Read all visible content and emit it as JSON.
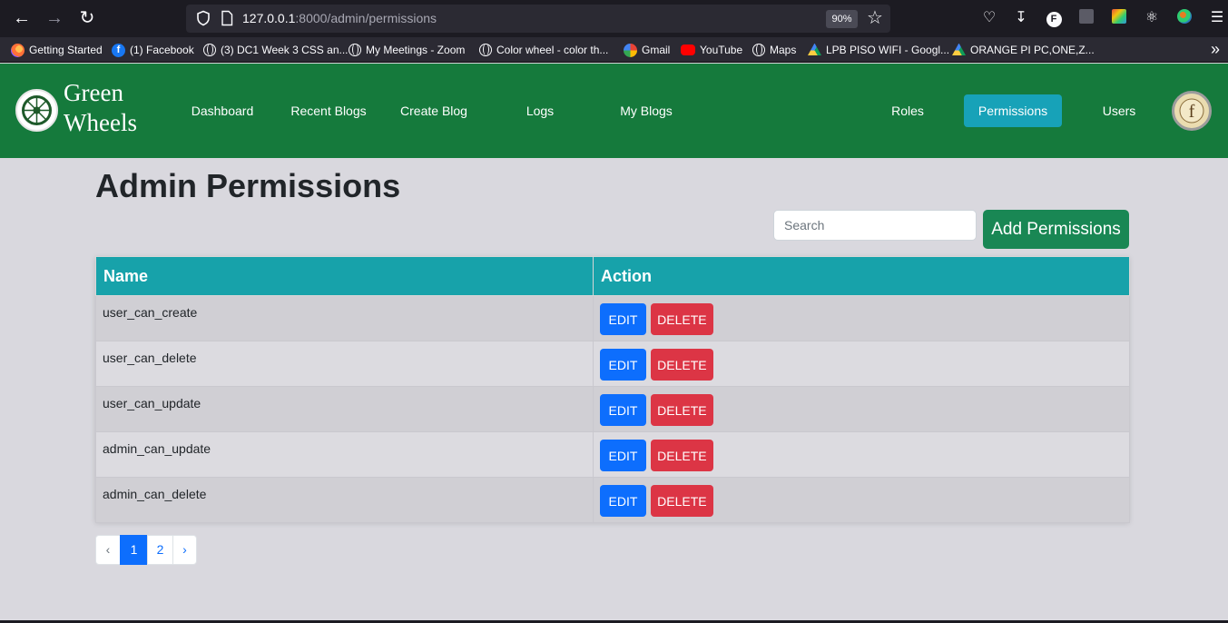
{
  "browser": {
    "url_host": "127.0.0.1",
    "url_rest": ":8000/admin/permissions",
    "zoom": "90%",
    "bookmarks": [
      {
        "label": "Getting Started",
        "icon": "firefox-icon"
      },
      {
        "label": "(1) Facebook",
        "icon": "facebook-icon"
      },
      {
        "label": "(3) DC1 Week 3 CSS an...",
        "icon": "globe-icon"
      },
      {
        "label": "My Meetings - Zoom",
        "icon": "globe-icon"
      },
      {
        "label": "Color wheel - color th...",
        "icon": "globe-icon"
      },
      {
        "label": "Gmail",
        "icon": "google-icon"
      },
      {
        "label": "YouTube",
        "icon": "youtube-icon"
      },
      {
        "label": "Maps",
        "icon": "globe-icon"
      },
      {
        "label": "LPB PISO WIFI - Googl...",
        "icon": "drive-icon"
      },
      {
        "label": "ORANGE PI PC,ONE,Z...",
        "icon": "drive-icon"
      }
    ]
  },
  "header": {
    "logo_line1": "Green",
    "logo_line2": "Wheels",
    "nav": [
      {
        "label": "Dashboard"
      },
      {
        "label": "Recent Blogs"
      },
      {
        "label": "Create Blog"
      },
      {
        "label": "Logs"
      },
      {
        "label": "My Blogs"
      }
    ],
    "right_nav": [
      {
        "label": "Roles",
        "active": false
      },
      {
        "label": "Permissions",
        "active": true
      },
      {
        "label": "Users",
        "active": false
      }
    ]
  },
  "main": {
    "title": "Admin Permissions",
    "search_placeholder": "Search",
    "add_button": "Add Permissions",
    "columns": [
      "Name",
      "Action"
    ],
    "edit_label": "EDIT",
    "delete_label": "DELETE",
    "rows": [
      {
        "name": "user_can_create"
      },
      {
        "name": "user_can_delete"
      },
      {
        "name": "user_can_update"
      },
      {
        "name": "admin_can_update"
      },
      {
        "name": "admin_can_delete"
      }
    ],
    "pagination": {
      "prev": "‹",
      "pages": [
        "1",
        "2"
      ],
      "current": "1",
      "next": "›"
    }
  },
  "colors": {
    "header_bg": "#157a3c",
    "active_nav": "#17a2b8",
    "table_header": "#17a2aa",
    "add_button": "#198754",
    "edit_button": "#0d6efd",
    "delete_button": "#dc3545"
  }
}
